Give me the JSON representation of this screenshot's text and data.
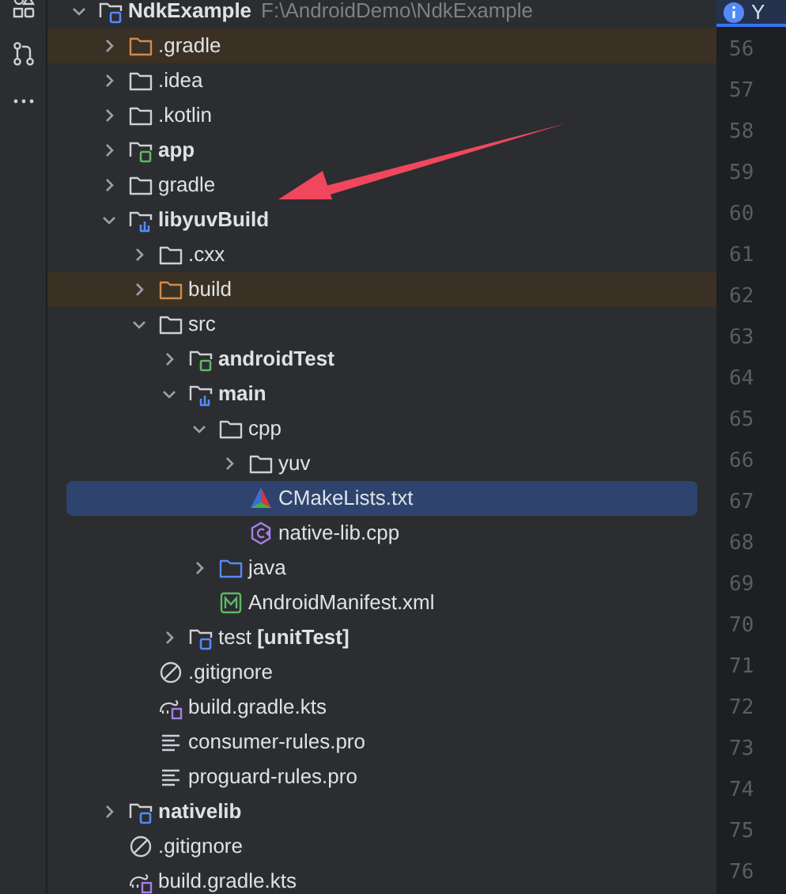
{
  "project_tree": [
    {
      "label": "NdkExample",
      "path": "F:\\AndroidDemo\\NdkExample",
      "kind": "module",
      "bold": true,
      "expanded": true,
      "selected": false,
      "excluded": false,
      "children": [
        {
          "label": ".gradle",
          "kind": "folder-excluded",
          "bold": false,
          "expanded": false,
          "selected": false,
          "excluded": true
        },
        {
          "label": ".idea",
          "kind": "folder",
          "bold": false,
          "expanded": false,
          "selected": false,
          "excluded": false
        },
        {
          "label": ".kotlin",
          "kind": "folder",
          "bold": false,
          "expanded": false,
          "selected": false,
          "excluded": false
        },
        {
          "label": "app",
          "kind": "module-app",
          "bold": true,
          "expanded": false,
          "selected": false,
          "excluded": false
        },
        {
          "label": "gradle",
          "kind": "folder",
          "bold": false,
          "expanded": false,
          "selected": false,
          "excluded": false
        },
        {
          "label": "libyuvBuild",
          "kind": "module-lib",
          "bold": true,
          "expanded": true,
          "selected": false,
          "excluded": false,
          "children": [
            {
              "label": ".cxx",
              "kind": "folder",
              "bold": false,
              "expanded": false,
              "selected": false,
              "excluded": false
            },
            {
              "label": "build",
              "kind": "folder-excluded",
              "bold": false,
              "expanded": false,
              "selected": false,
              "excluded": true
            },
            {
              "label": "src",
              "kind": "folder",
              "bold": false,
              "expanded": true,
              "selected": false,
              "excluded": false,
              "children": [
                {
                  "label": "androidTest",
                  "kind": "module-app",
                  "bold": true,
                  "expanded": false,
                  "selected": false,
                  "excluded": false
                },
                {
                  "label": "main",
                  "kind": "module-lib",
                  "bold": true,
                  "expanded": true,
                  "selected": false,
                  "excluded": false,
                  "children": [
                    {
                      "label": "cpp",
                      "kind": "folder",
                      "bold": false,
                      "expanded": true,
                      "selected": false,
                      "excluded": false,
                      "children": [
                        {
                          "label": "yuv",
                          "kind": "folder",
                          "bold": false,
                          "expanded": false,
                          "selected": false,
                          "excluded": false
                        },
                        {
                          "label": "CMakeLists.txt",
                          "kind": "cmake",
                          "bold": false,
                          "selected": true,
                          "excluded": false
                        },
                        {
                          "label": "native-lib.cpp",
                          "kind": "cpp",
                          "bold": false,
                          "selected": false,
                          "excluded": false
                        }
                      ]
                    },
                    {
                      "label": "java",
                      "kind": "source-folder",
                      "bold": false,
                      "expanded": false,
                      "selected": false,
                      "excluded": false
                    },
                    {
                      "label": "AndroidManifest.xml",
                      "kind": "manifest",
                      "bold": false,
                      "selected": false,
                      "excluded": false
                    }
                  ]
                },
                {
                  "label": "test **[unitTest]**",
                  "kind": "module",
                  "bold": false,
                  "expanded": false,
                  "selected": false,
                  "excluded": false
                }
              ]
            },
            {
              "label": ".gitignore",
              "kind": "ignore",
              "bold": false,
              "selected": false,
              "excluded": false
            },
            {
              "label": "build.gradle.kts",
              "kind": "gradle",
              "bold": false,
              "selected": false,
              "excluded": false
            },
            {
              "label": "consumer-rules.pro",
              "kind": "text",
              "bold": false,
              "selected": false,
              "excluded": false
            },
            {
              "label": "proguard-rules.pro",
              "kind": "text",
              "bold": false,
              "selected": false,
              "excluded": false
            }
          ]
        },
        {
          "label": "nativelib",
          "kind": "module",
          "bold": true,
          "expanded": false,
          "selected": false,
          "excluded": false
        },
        {
          "label": ".gitignore",
          "kind": "ignore",
          "bold": false,
          "selected": false,
          "excluded": false
        },
        {
          "label": "build.gradle.kts",
          "kind": "gradle",
          "bold": false,
          "selected": false,
          "excluded": false
        }
      ]
    }
  ],
  "editor": {
    "tab": {
      "label": "Y"
    },
    "line_numbers": [
      "56",
      "57",
      "58",
      "59",
      "60",
      "61",
      "62",
      "63",
      "64",
      "65",
      "66",
      "67",
      "68",
      "69",
      "70",
      "71",
      "72",
      "73",
      "74",
      "75",
      "76"
    ]
  }
}
